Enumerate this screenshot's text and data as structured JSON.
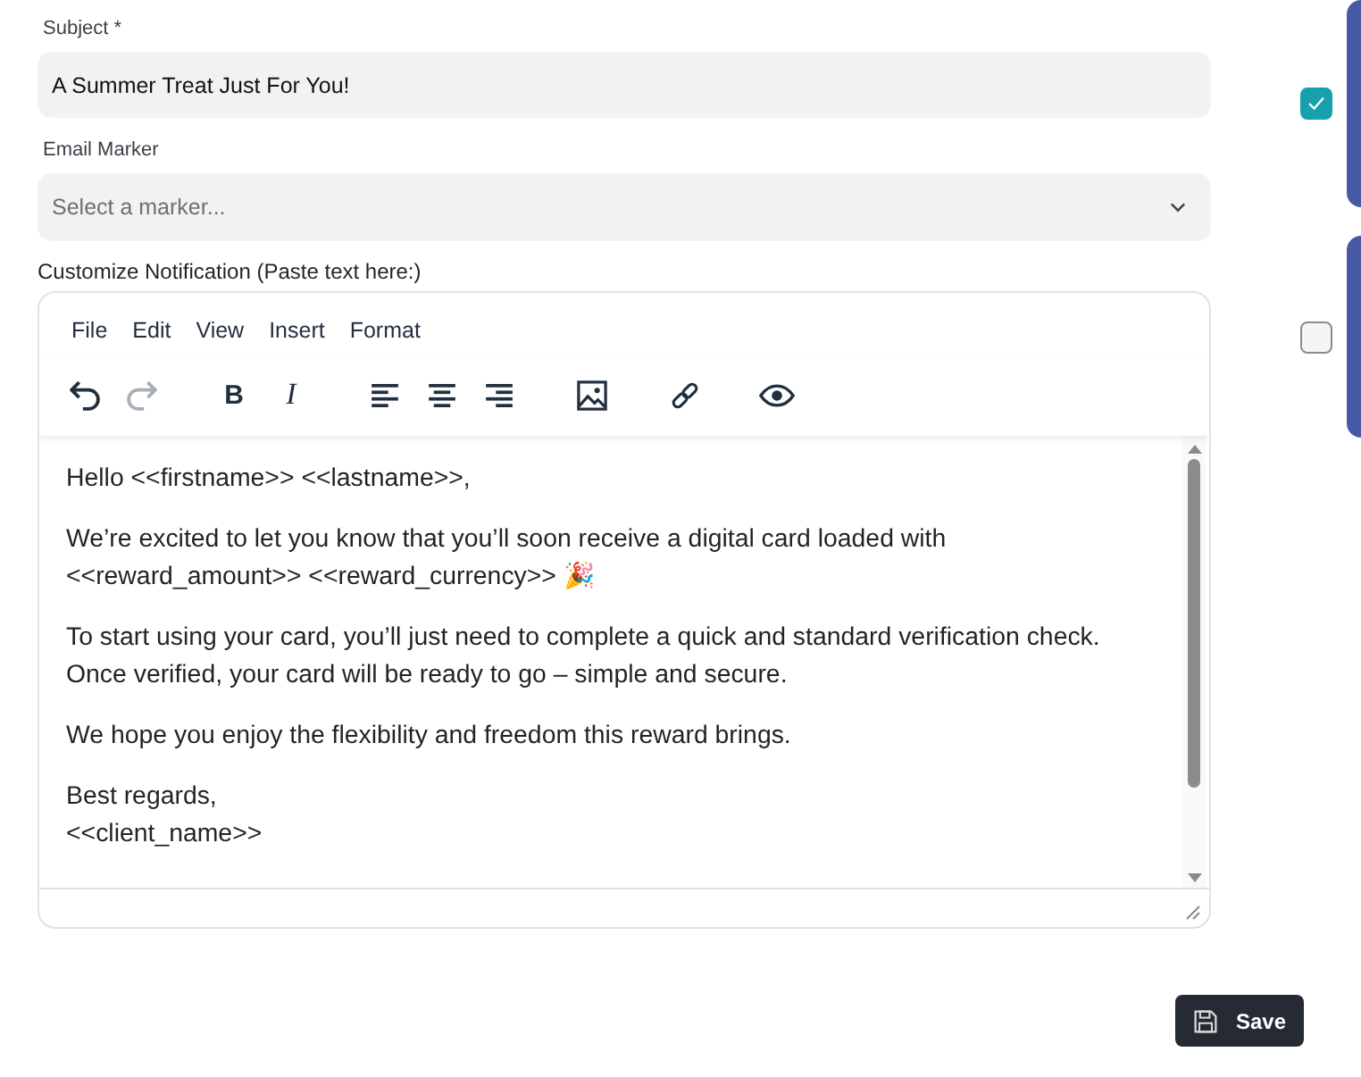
{
  "subject": {
    "label": "Subject *",
    "value": "A Summer Treat Just For You!"
  },
  "email_marker": {
    "label": "Email Marker",
    "placeholder": "Select a marker..."
  },
  "notification_editor": {
    "label": "Customize Notification (Paste text here:)",
    "menu": [
      "File",
      "Edit",
      "View",
      "Insert",
      "Format"
    ],
    "toolbar": [
      [
        {
          "kind": "undo",
          "disabled": false
        },
        {
          "kind": "redo",
          "disabled": true
        }
      ],
      [
        {
          "kind": "bold",
          "label": "B",
          "disabled": false
        },
        {
          "kind": "italic",
          "label": "I",
          "disabled": false
        }
      ],
      [
        {
          "kind": "align-left",
          "disabled": false
        },
        {
          "kind": "align-center",
          "disabled": false
        },
        {
          "kind": "align-right",
          "disabled": false
        }
      ],
      [
        {
          "kind": "image",
          "disabled": false
        }
      ],
      [
        {
          "kind": "link",
          "disabled": false
        }
      ],
      [
        {
          "kind": "preview",
          "disabled": false
        }
      ]
    ],
    "paragraphs": [
      {
        "lines": [
          "Hello <<firstname>> <<lastname>>,"
        ]
      },
      {
        "lines": [
          "We’re excited to let you know that you’ll soon receive a digital card loaded with",
          "<<reward_amount>> <<reward_currency>> 🎉"
        ]
      },
      {
        "lines": [
          "To start using your card, you’ll just need to complete a quick and standard verification check.",
          "Once verified, your card will be ready to go – simple and secure."
        ]
      },
      {
        "lines": [
          "We hope you enjoy the flexibility and freedom this reward brings."
        ]
      },
      {
        "lines": [
          "Best regards,",
          "<<client_name>>"
        ]
      }
    ]
  },
  "side_cards": [
    {
      "checked": true
    },
    {
      "checked": false
    }
  ],
  "save_button": {
    "label": "Save"
  }
}
